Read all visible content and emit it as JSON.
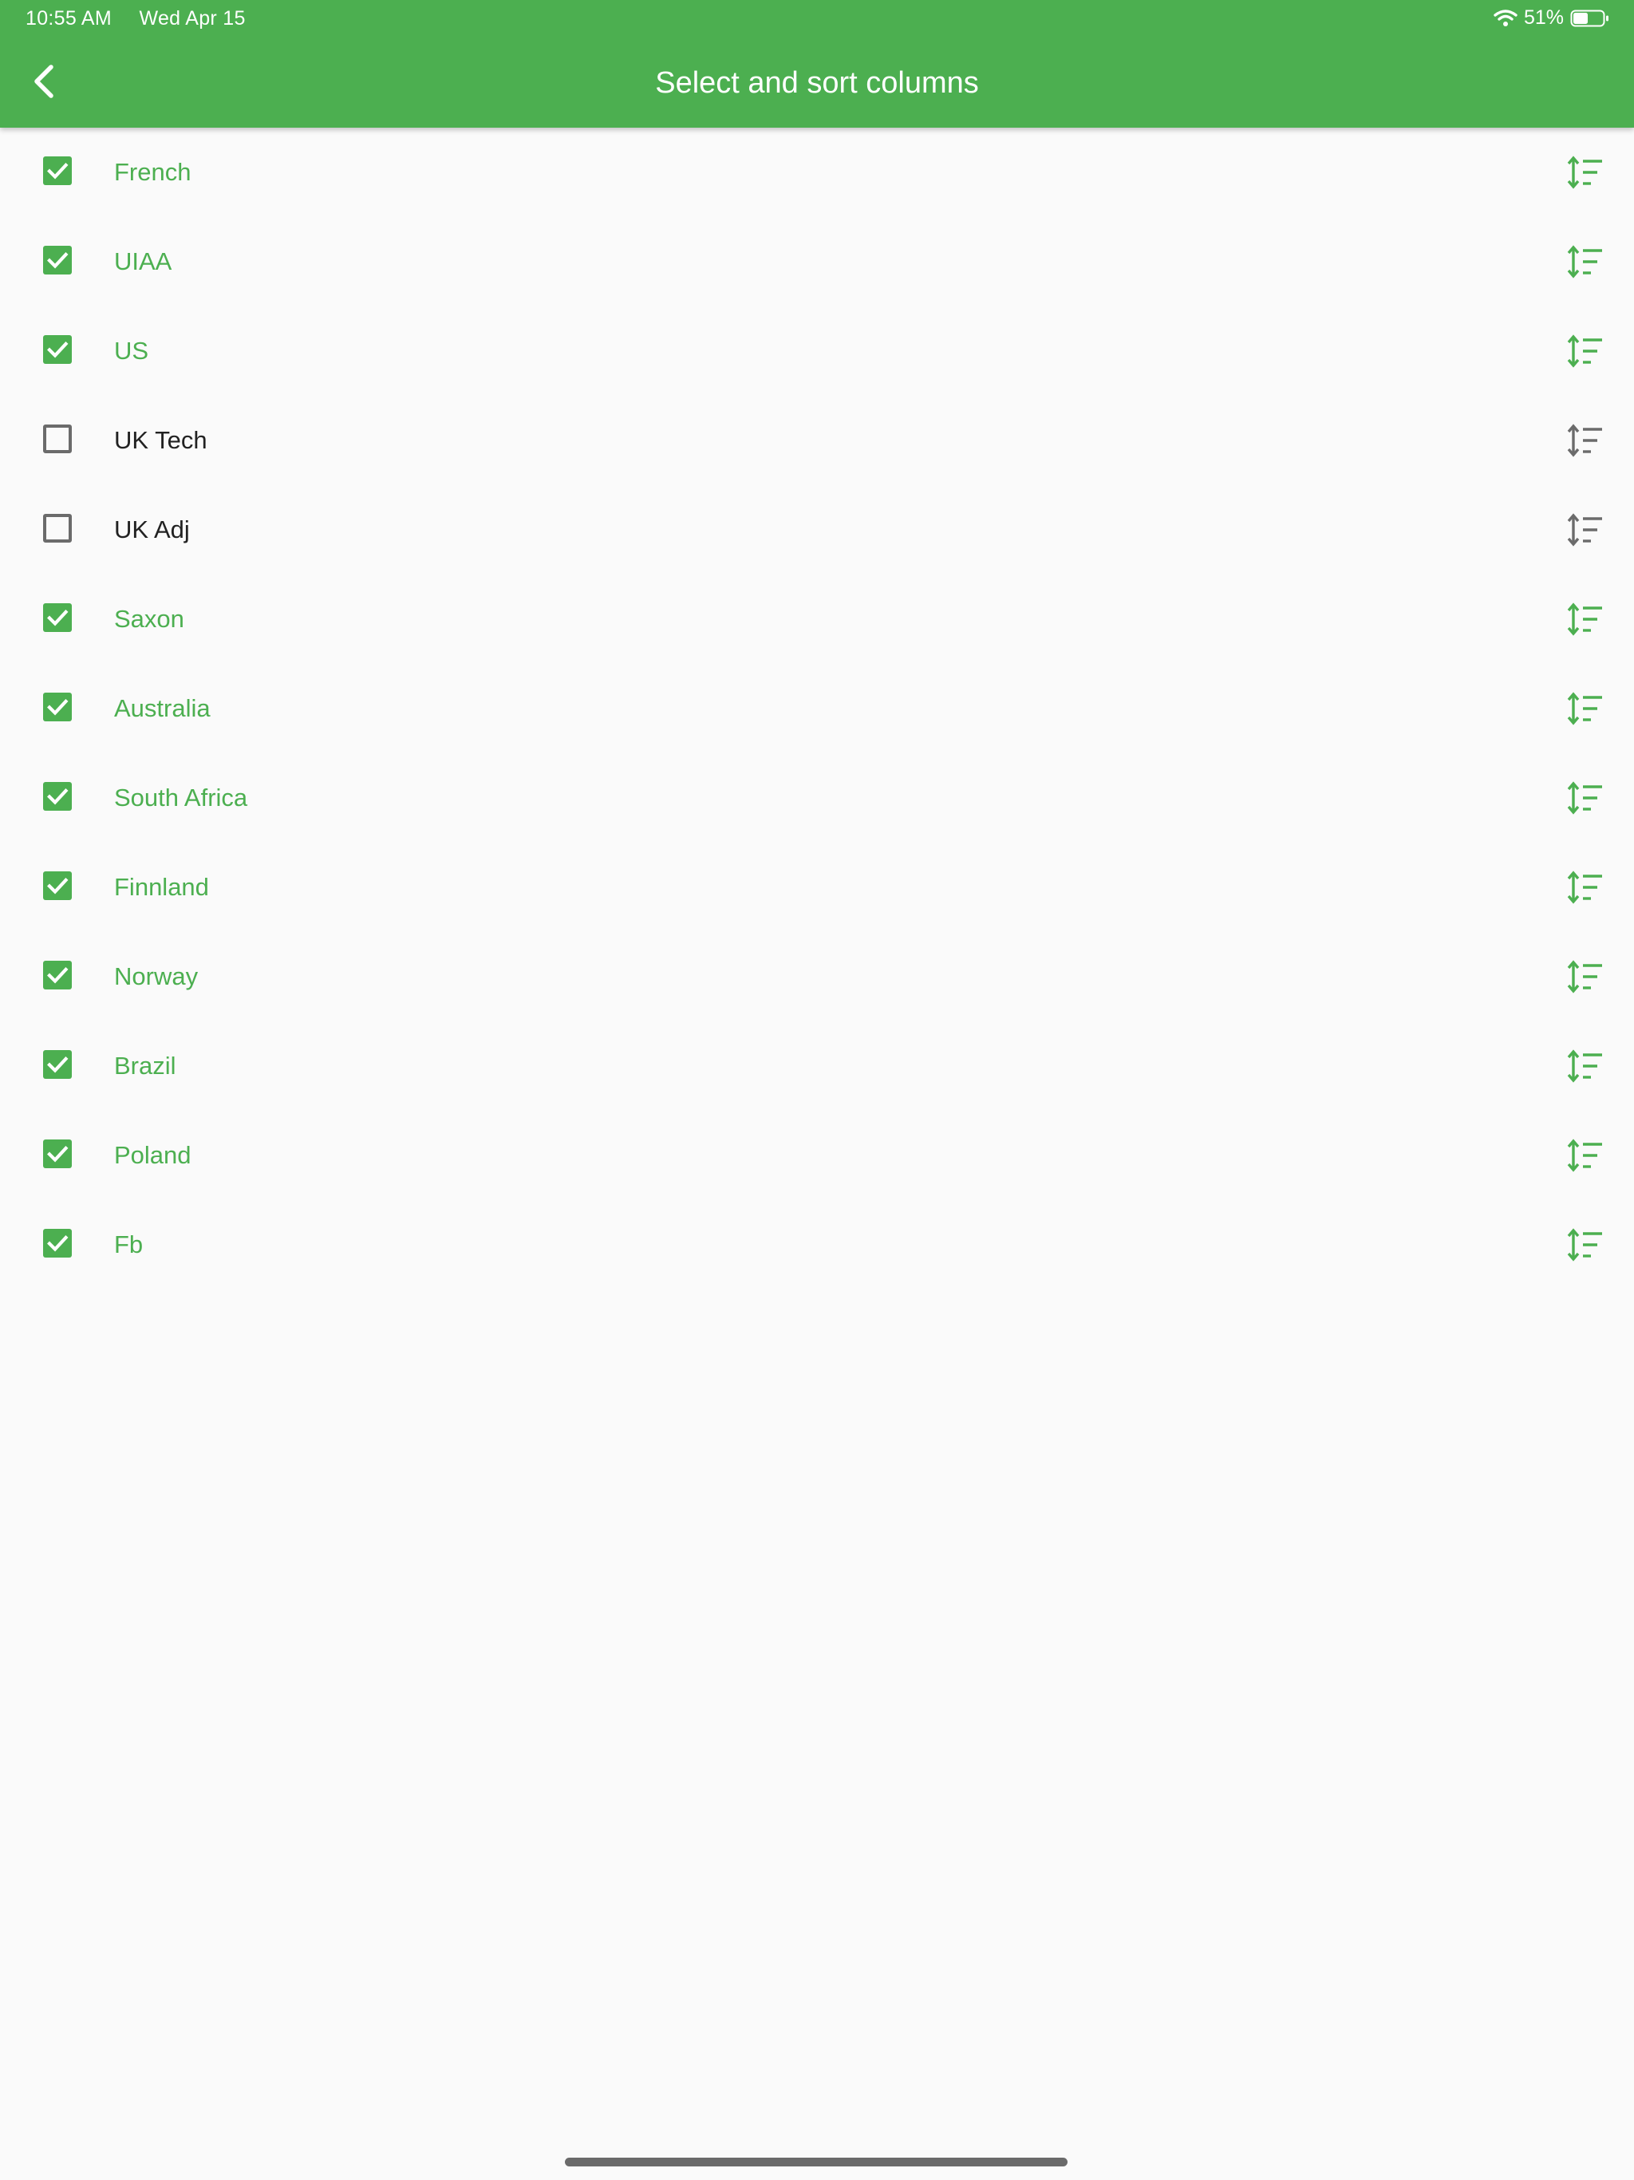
{
  "status_bar": {
    "time": "10:55 AM",
    "date": "Wed Apr 15",
    "battery_percent": "51%",
    "battery_level": 0.51,
    "wifi_icon": "wifi-icon",
    "battery_icon": "battery-icon"
  },
  "toolbar": {
    "title": "Select and sort columns",
    "back_icon": "chevron-left-icon"
  },
  "colors": {
    "accent": "#4caf50",
    "unchecked": "#6b6b6b",
    "text_unselected": "#222222"
  },
  "columns": [
    {
      "label": "French",
      "checked": true
    },
    {
      "label": "UIAA",
      "checked": true
    },
    {
      "label": "US",
      "checked": true
    },
    {
      "label": "UK Tech",
      "checked": false
    },
    {
      "label": "UK Adj",
      "checked": false
    },
    {
      "label": "Saxon",
      "checked": true
    },
    {
      "label": "Australia",
      "checked": true
    },
    {
      "label": "South Africa",
      "checked": true
    },
    {
      "label": "Finnland",
      "checked": true
    },
    {
      "label": "Norway",
      "checked": true
    },
    {
      "label": "Brazil",
      "checked": true
    },
    {
      "label": "Poland",
      "checked": true
    },
    {
      "label": "Fb",
      "checked": true
    }
  ],
  "row_icons": {
    "checkbox": "checkbox-icon",
    "sort": "sort-handle-icon"
  }
}
